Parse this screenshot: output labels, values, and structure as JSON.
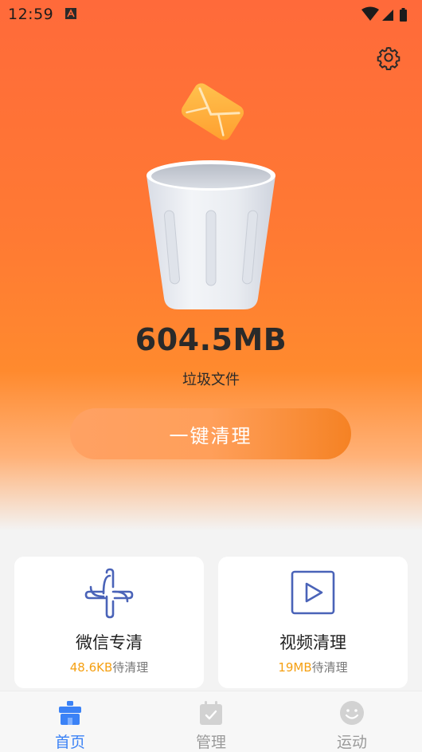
{
  "status_bar": {
    "time": "12:59"
  },
  "hero": {
    "junk_size": "604.5MB",
    "junk_label": "垃圾文件",
    "clean_button_label": "一键清理"
  },
  "cards": [
    {
      "title": "微信专清",
      "amount": "48.6KB",
      "suffix": "待清理",
      "icon": "wechat-clean-icon"
    },
    {
      "title": "视频清理",
      "amount": "19MB",
      "suffix": "待清理",
      "icon": "video-play-icon"
    }
  ],
  "bottom_nav": [
    {
      "label": "首页",
      "icon": "home-icon",
      "active": true
    },
    {
      "label": "管理",
      "icon": "calendar-check-icon",
      "active": false
    },
    {
      "label": "运动",
      "icon": "smiley-icon",
      "active": false
    }
  ],
  "colors": {
    "accent_orange": "#ff7a33",
    "amount_orange": "#f5a012",
    "nav_active_blue": "#3b82f6",
    "icon_blue": "#4a63b8"
  }
}
